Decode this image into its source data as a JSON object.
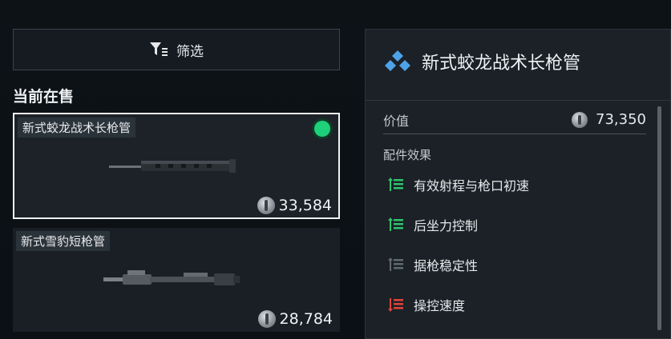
{
  "filter": {
    "label": "筛选",
    "icon": "filter-icon"
  },
  "section_title": "当前在售",
  "items": [
    {
      "name": "新式蛟龙战术长枪管",
      "price": "33,584",
      "selected": true,
      "status_color": "#1ed07a"
    },
    {
      "name": "新式雪豹短枪管",
      "price": "28,784",
      "selected": false
    }
  ],
  "details": {
    "title": "新式蛟龙战术长枪管",
    "rarity_color": "#4ea3e8",
    "value_label": "价值",
    "value": "73,350",
    "effects_label": "配件效果",
    "effects": [
      {
        "label": "有效射程与枪口初速",
        "direction": "up",
        "color": "#2fc46e"
      },
      {
        "label": "后坐力控制",
        "direction": "up",
        "color": "#2fc46e"
      },
      {
        "label": "据枪稳定性",
        "direction": "neutral",
        "color": "#5f6a72"
      },
      {
        "label": "操控速度",
        "direction": "down",
        "color": "#e0443a"
      }
    ]
  }
}
